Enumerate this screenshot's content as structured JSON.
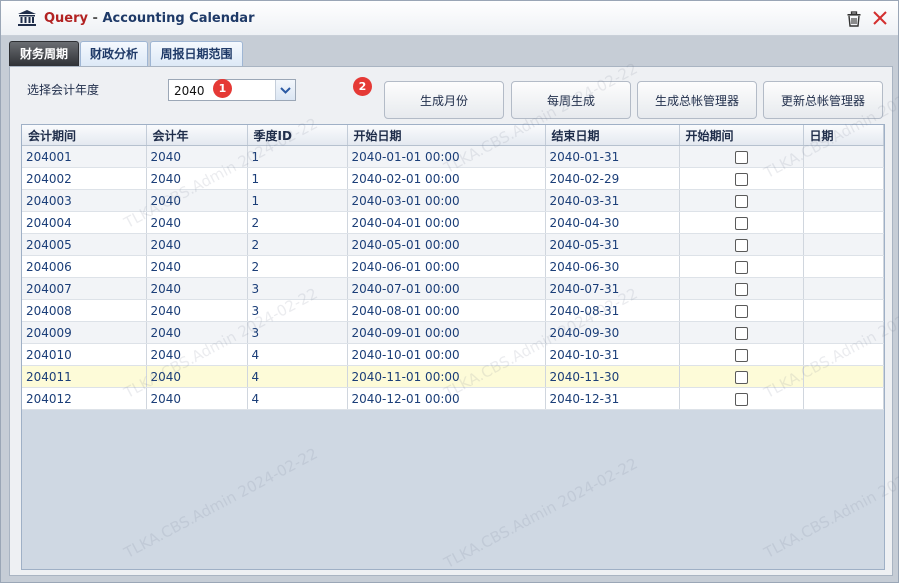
{
  "window": {
    "title_prefix": "Query",
    "title_separator": "-",
    "title_name": "Accounting Calendar"
  },
  "tabs": [
    {
      "label": "财务周期",
      "active": true
    },
    {
      "label": "财政分析",
      "active": false
    },
    {
      "label": "周报日期范围",
      "active": false
    }
  ],
  "filter": {
    "year_label": "选择会计年度",
    "year_value": "2040",
    "badge1": "1",
    "badge2": "2"
  },
  "buttons": {
    "generate_month": "生成月份",
    "weekly_generate": "每周生成",
    "generate_gl_manager": "生成总帐管理器",
    "update_gl_manager": "更新总帐管理器"
  },
  "table": {
    "columns": [
      "会计期间",
      "会计年",
      "季度ID",
      "开始日期",
      "结束日期",
      "开始期间",
      "日期"
    ],
    "rows": [
      {
        "period": "204001",
        "year": "2040",
        "quarter": "1",
        "start": "2040-01-01 00:00",
        "end": "2040-01-31",
        "start_period": false,
        "date": ""
      },
      {
        "period": "204002",
        "year": "2040",
        "quarter": "1",
        "start": "2040-02-01 00:00",
        "end": "2040-02-29",
        "start_period": false,
        "date": ""
      },
      {
        "period": "204003",
        "year": "2040",
        "quarter": "1",
        "start": "2040-03-01 00:00",
        "end": "2040-03-31",
        "start_period": false,
        "date": ""
      },
      {
        "period": "204004",
        "year": "2040",
        "quarter": "2",
        "start": "2040-04-01 00:00",
        "end": "2040-04-30",
        "start_period": false,
        "date": ""
      },
      {
        "period": "204005",
        "year": "2040",
        "quarter": "2",
        "start": "2040-05-01 00:00",
        "end": "2040-05-31",
        "start_period": false,
        "date": ""
      },
      {
        "period": "204006",
        "year": "2040",
        "quarter": "2",
        "start": "2040-06-01 00:00",
        "end": "2040-06-30",
        "start_period": false,
        "date": ""
      },
      {
        "period": "204007",
        "year": "2040",
        "quarter": "3",
        "start": "2040-07-01 00:00",
        "end": "2040-07-31",
        "start_period": false,
        "date": ""
      },
      {
        "period": "204008",
        "year": "2040",
        "quarter": "3",
        "start": "2040-08-01 00:00",
        "end": "2040-08-31",
        "start_period": false,
        "date": ""
      },
      {
        "period": "204009",
        "year": "2040",
        "quarter": "3",
        "start": "2040-09-01 00:00",
        "end": "2040-09-30",
        "start_period": false,
        "date": ""
      },
      {
        "period": "204010",
        "year": "2040",
        "quarter": "4",
        "start": "2040-10-01 00:00",
        "end": "2040-10-31",
        "start_period": false,
        "date": ""
      },
      {
        "period": "204011",
        "year": "2040",
        "quarter": "4",
        "start": "2040-11-01 00:00",
        "end": "2040-11-30",
        "start_period": false,
        "date": "",
        "highlighted": true
      },
      {
        "period": "204012",
        "year": "2040",
        "quarter": "4",
        "start": "2040-12-01 00:00",
        "end": "2040-12-31",
        "start_period": false,
        "date": ""
      }
    ]
  },
  "watermark": "TLKA.CBS.Admin 2024-02-22",
  "colors": {
    "badge": "#e53935",
    "highlight_row": "#fdfbd8",
    "title_query": "#b22222",
    "active_tab": "#2d2f33"
  }
}
